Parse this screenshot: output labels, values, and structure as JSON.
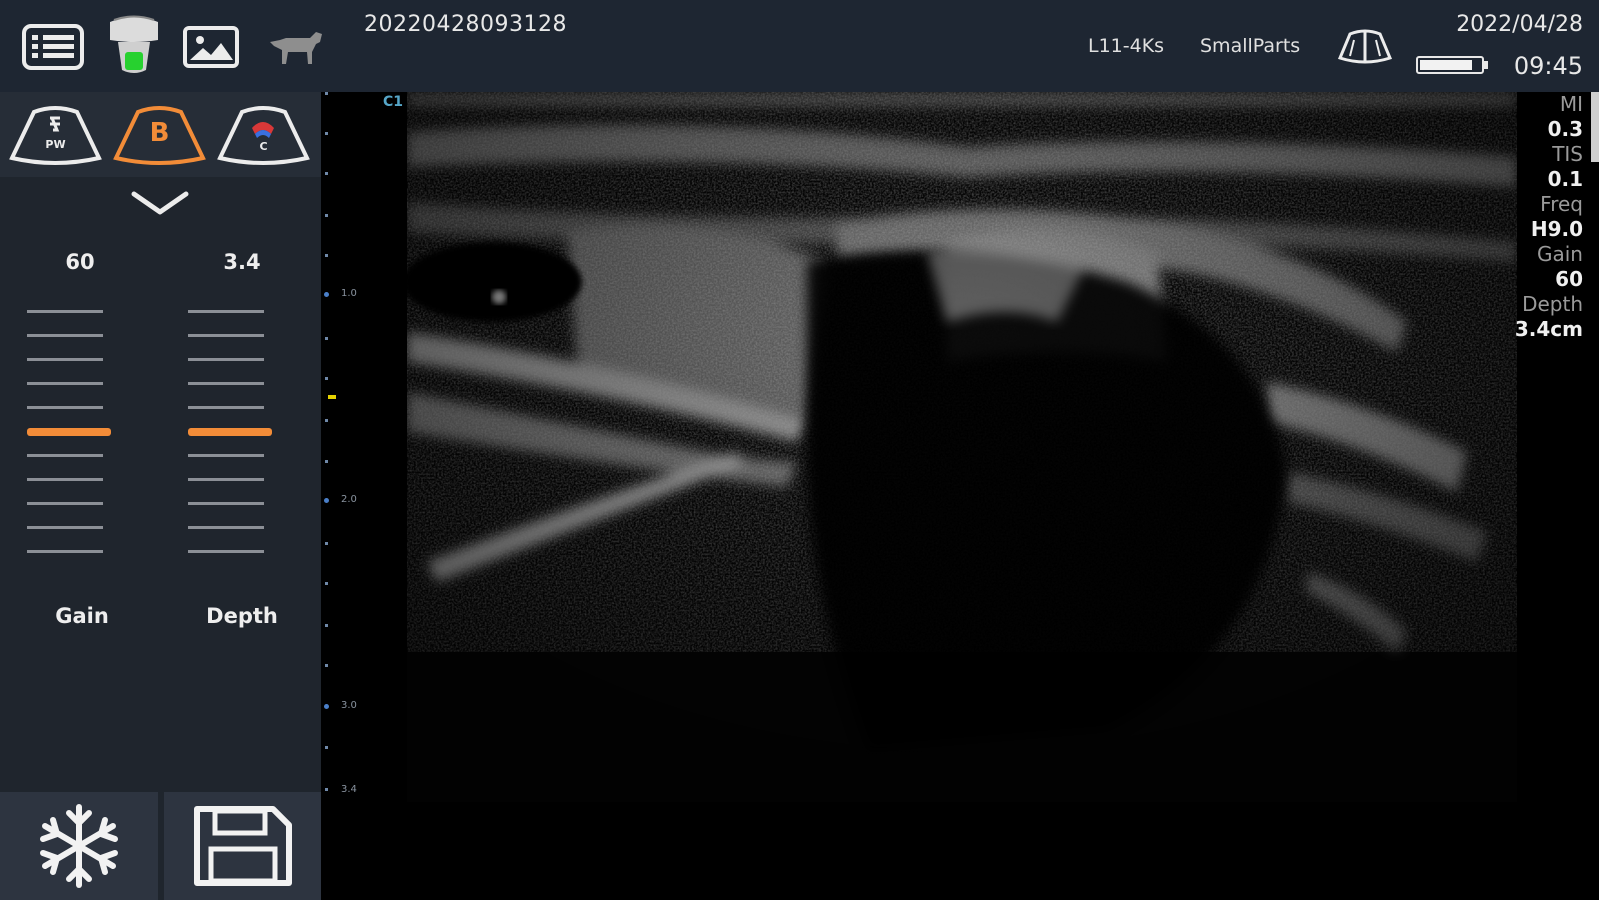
{
  "topbar": {
    "exam_id": "20220428093128",
    "probe": "L11-4Ks",
    "preset": "SmallParts",
    "date": "2022/04/28",
    "time": "09:45",
    "battery_level": 0.92,
    "icons": [
      "list-icon",
      "probe-status-icon",
      "image-gallery-icon",
      "dog-icon",
      "probe-orientation-icon"
    ]
  },
  "modes": [
    {
      "label": "PW",
      "state": "inactive",
      "icon": "pw-mode-icon"
    },
    {
      "label": "B",
      "state": "active",
      "icon": "b-mode-icon"
    },
    {
      "label": "C",
      "state": "inactive",
      "icon": "color-mode-icon"
    }
  ],
  "controls": {
    "gain": {
      "label": "Gain",
      "value": "60",
      "ticks": 11,
      "active_tick": 5
    },
    "depth": {
      "label": "Depth",
      "value": "3.4",
      "ticks": 11,
      "active_tick": 5
    }
  },
  "actions": {
    "freeze_icon": "snowflake-icon",
    "save_icon": "save-icon"
  },
  "image": {
    "scale_labels": [
      "1.0",
      "2.0",
      "3.0",
      "3.4"
    ],
    "marker_label": "C1"
  },
  "info": {
    "mi_label": "MI",
    "mi_value": "0.3",
    "tis_label": "TIS",
    "tis_value": "0.1",
    "freq_label": "Freq",
    "freq_value": "H9.0",
    "gain_label": "Gain",
    "gain_value": "60",
    "depth_label": "Depth",
    "depth_value": "3.4cm"
  },
  "colors": {
    "accent": "#f28c38",
    "panel": "#1f252d",
    "topbar": "#1e2632",
    "probe_ok": "#27d12f"
  }
}
